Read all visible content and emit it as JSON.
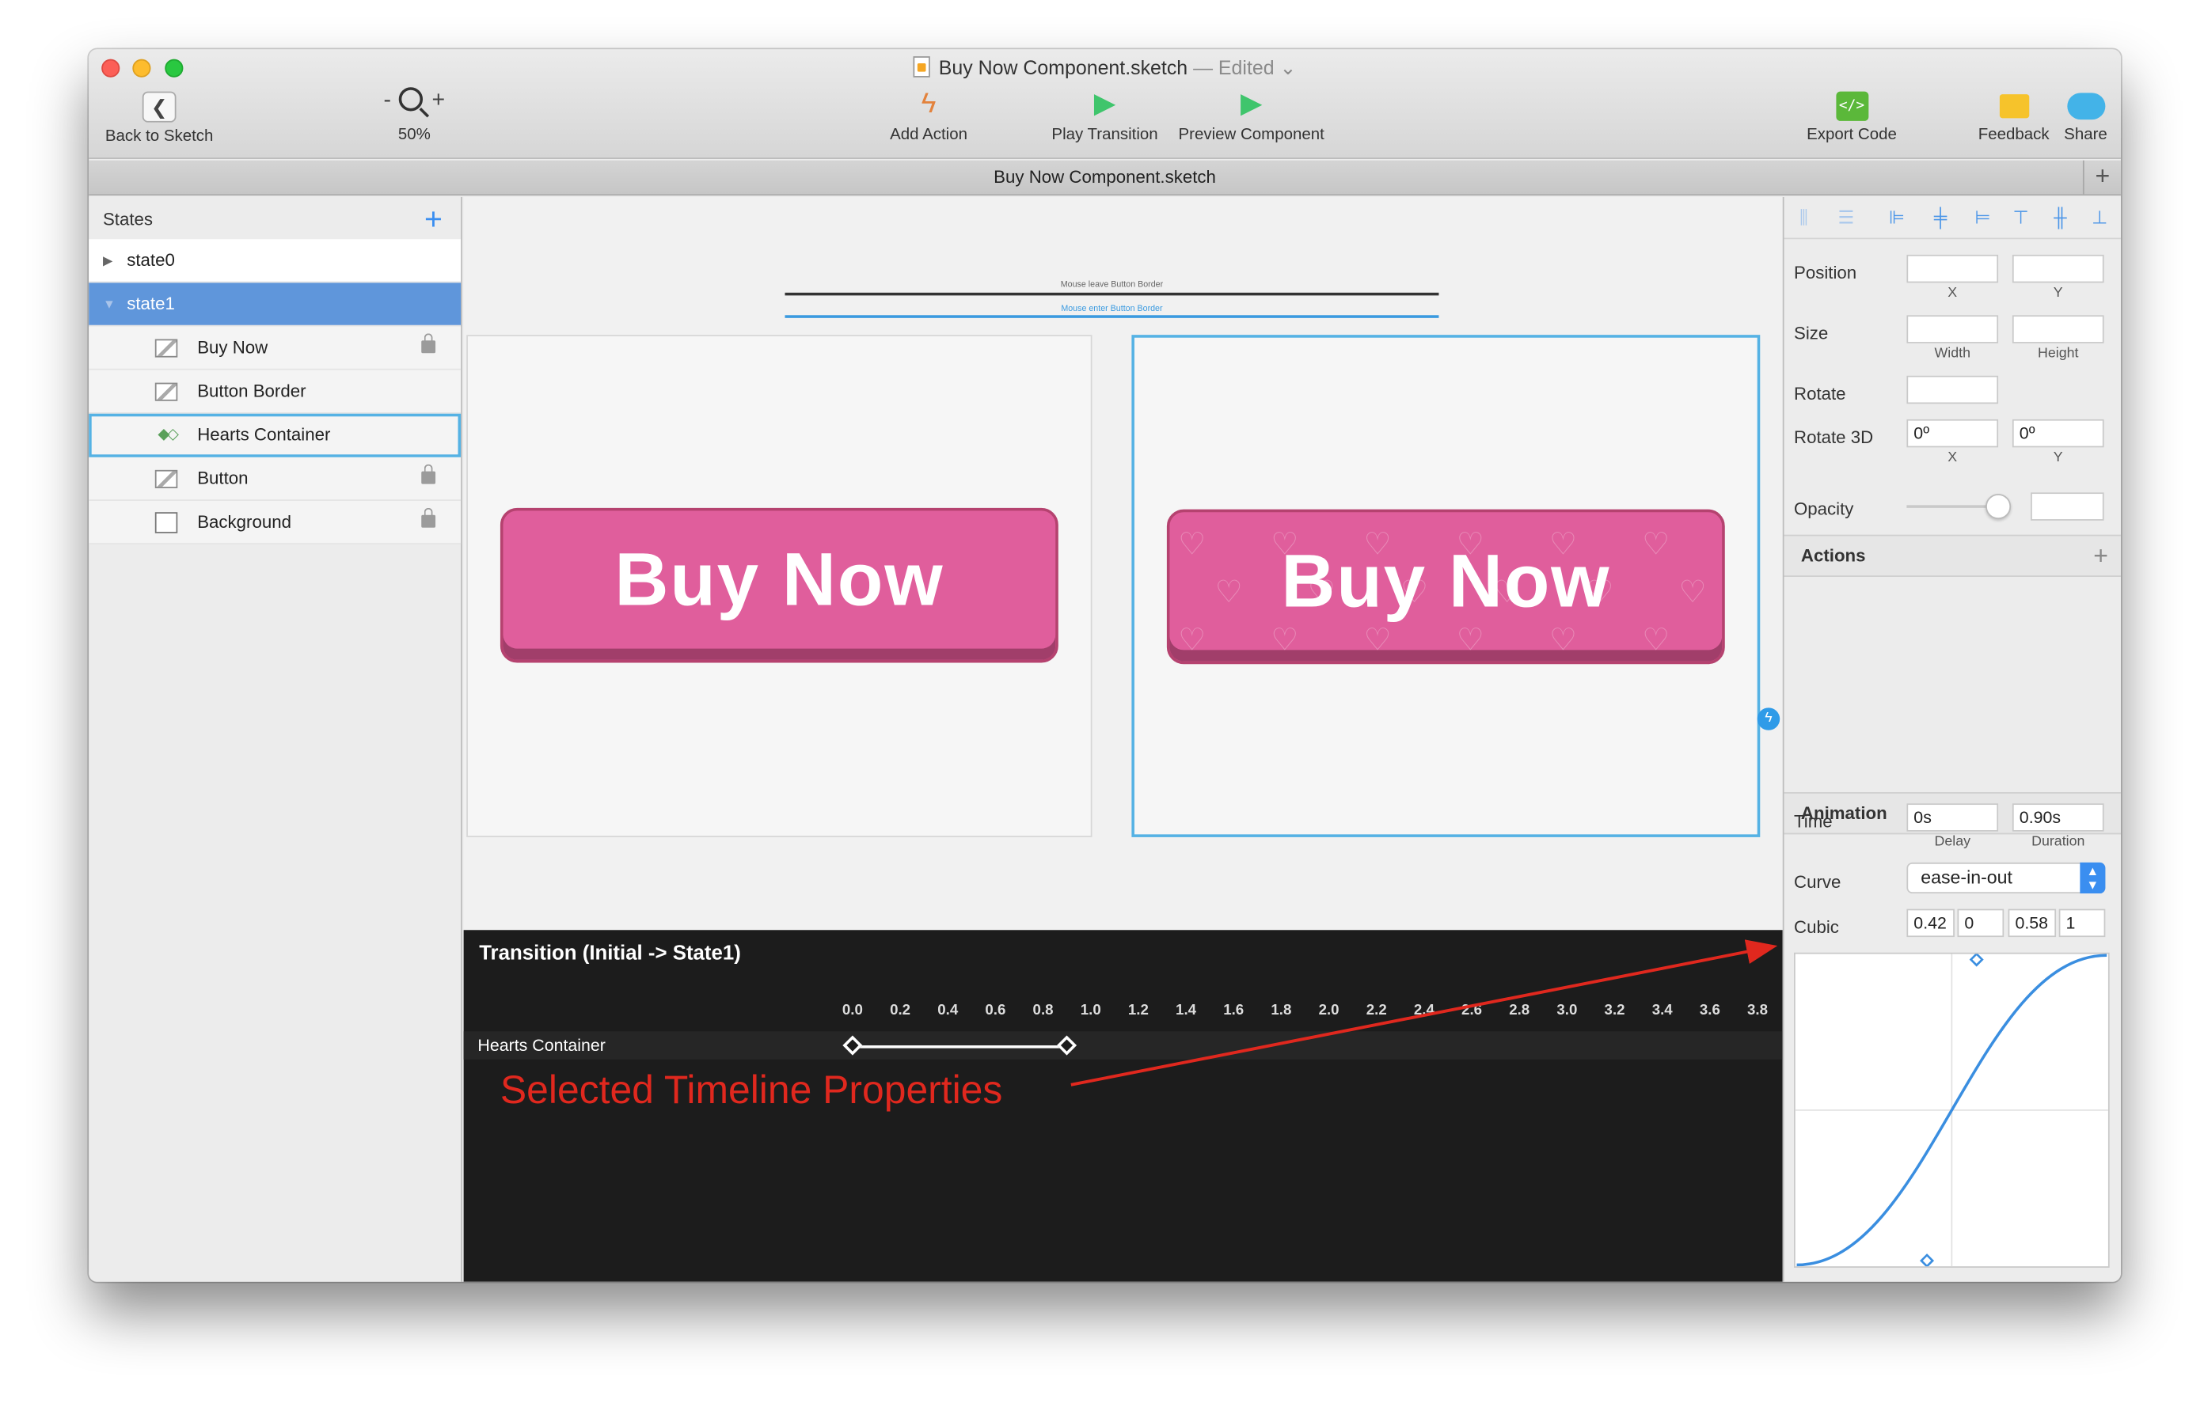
{
  "window": {
    "title": "Buy Now Component.sketch",
    "edited": "— Edited",
    "tab_title": "Buy Now Component.sketch"
  },
  "toolbar": {
    "back": "Back to Sketch",
    "zoom_minus": "-",
    "zoom_plus": "+",
    "zoom_level": "50%",
    "add_action": "Add Action",
    "play_transition": "Play Transition",
    "preview_component": "Preview Component",
    "export_code": "Export Code",
    "export_glyph": "</>",
    "feedback": "Feedback",
    "share": "Share"
  },
  "sidebar": {
    "header": "States",
    "states": [
      {
        "label": "state0"
      },
      {
        "label": "state1"
      }
    ],
    "layers": [
      {
        "label": "Buy Now",
        "locked": true
      },
      {
        "label": "Button Border",
        "locked": false
      },
      {
        "label": "Hearts Container",
        "locked": false
      },
      {
        "label": "Button",
        "locked": true
      },
      {
        "label": "Background",
        "locked": true
      }
    ]
  },
  "canvas": {
    "button_text": "Buy Now",
    "line_leave_label": "Mouse leave Button Border",
    "line_enter_label": "Mouse enter Button Border"
  },
  "timeline": {
    "title": "Transition (Initial -> State1)",
    "ticks": [
      "0.0",
      "0.2",
      "0.4",
      "0.6",
      "0.8",
      "1.0",
      "1.2",
      "1.4",
      "1.6",
      "1.8",
      "2.0",
      "2.2",
      "2.4",
      "2.6",
      "2.8",
      "3.0",
      "3.2",
      "3.4",
      "3.6",
      "3.8"
    ],
    "row_name": "Hearts Container",
    "keyframe_start": 0.0,
    "keyframe_end": 0.9,
    "annotation": "Selected Timeline Properties"
  },
  "inspector": {
    "position_label": "Position",
    "size_label": "Size",
    "rotate_label": "Rotate",
    "rotate3d_label": "Rotate 3D",
    "rotate3d_x": "0º",
    "rotate3d_y": "0º",
    "opacity_label": "Opacity",
    "opacity_value": 0.9,
    "sub_x": "X",
    "sub_y": "Y",
    "sub_width": "Width",
    "sub_height": "Height",
    "actions_header": "Actions",
    "animation_header": "Animation",
    "time_label": "Time",
    "delay_value": "0s",
    "delay_sub": "Delay",
    "duration_value": "0.90s",
    "duration_sub": "Duration",
    "curve_label": "Curve",
    "curve_value": "ease-in-out",
    "cubic_label": "Cubic",
    "cubic": [
      "0.42",
      "0",
      "0.58",
      "1"
    ]
  },
  "colors": {
    "accent": "#3a8ef0",
    "selection": "#5f96db",
    "button": "#e05e9c",
    "annotation": "#e0281e",
    "curve": "#3a8ee0"
  }
}
